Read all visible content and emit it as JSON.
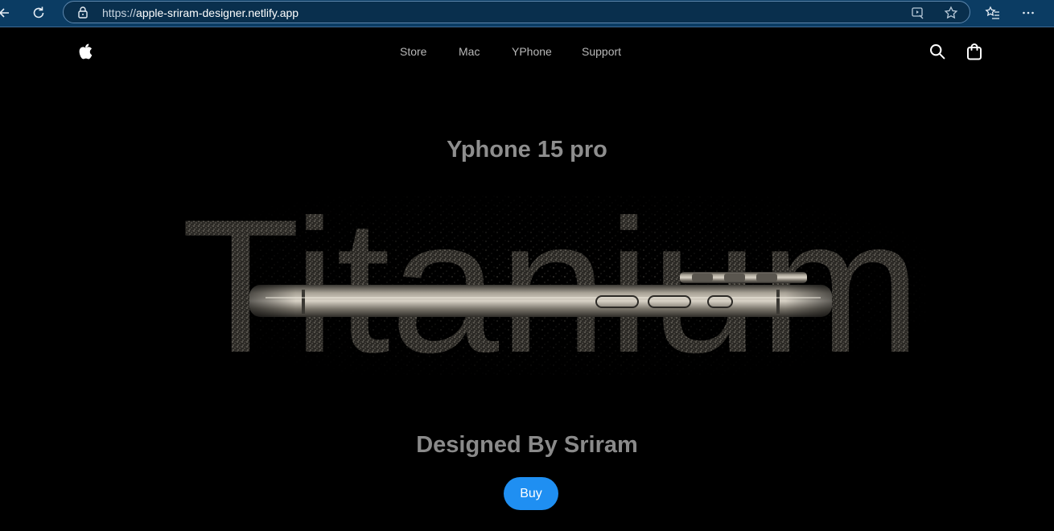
{
  "browser": {
    "url_scheme": "https://",
    "url_host": "apple-sriram-designer.netlify.app",
    "icons": [
      "back-icon",
      "refresh-icon",
      "lock-icon",
      "screen-read-icon",
      "favorite-star-icon",
      "favorites-icon",
      "more-icon"
    ]
  },
  "nav": {
    "links": [
      {
        "label": "Store"
      },
      {
        "label": "Mac"
      },
      {
        "label": "YPhone"
      },
      {
        "label": "Support"
      }
    ],
    "icons": [
      "apple-logo-icon",
      "search-icon",
      "bag-icon"
    ]
  },
  "hero": {
    "title": "Yphone 15 pro",
    "art_word": "Titanium",
    "tagline": "Designed By Sriram",
    "buy_label": "Buy",
    "accent": "#1f8ff2"
  }
}
